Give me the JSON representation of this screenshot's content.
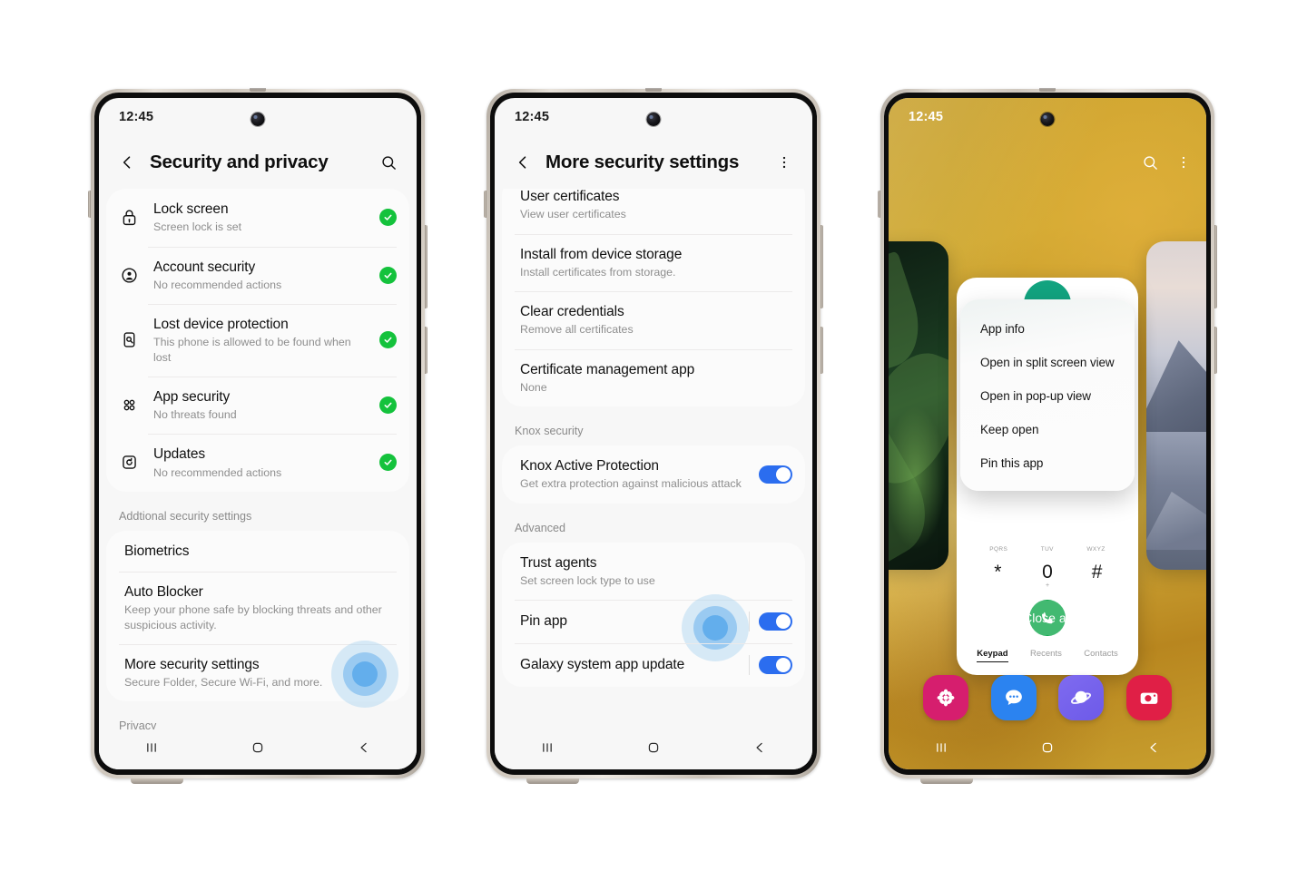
{
  "colors": {
    "accent_blue": "#2b6def",
    "ripple_blue": "#63aeec",
    "check_green": "#14c23c",
    "call_green": "#0ea64a",
    "wallpaper_gold": "#c8a02c",
    "frame_titanium": "#cfc7bd"
  },
  "phone1": {
    "status": {
      "time": "12:45"
    },
    "appbar": {
      "back_icon": "chevron-left-icon",
      "title": "Security and privacy",
      "action_icon": "search-icon"
    },
    "items": [
      {
        "icon": "lock-icon",
        "title": "Lock screen",
        "subtitle": "Screen lock is set",
        "status": "ok"
      },
      {
        "icon": "account-icon",
        "title": "Account security",
        "subtitle": "No recommended actions",
        "status": "ok"
      },
      {
        "icon": "find-phone-icon",
        "title": "Lost device protection",
        "subtitle": "This phone is allowed to be found when lost",
        "status": "ok"
      },
      {
        "icon": "apps-grid-icon",
        "title": "App security",
        "subtitle": "No threats found",
        "status": "ok"
      },
      {
        "icon": "update-icon",
        "title": "Updates",
        "subtitle": "No recommended actions",
        "status": "ok"
      }
    ],
    "section_header": "Addtional security settings",
    "items2": [
      {
        "title": "Biometrics",
        "subtitle": ""
      },
      {
        "title": "Auto Blocker",
        "subtitle": "Keep your phone safe by blocking threats and other suspicious activity."
      },
      {
        "title": "More security settings",
        "subtitle": "Secure Folder, Secure Wi-Fi, and more."
      }
    ],
    "section_header2": "Privacy",
    "navbar": {
      "recents": "recents-icon",
      "home": "home-icon",
      "back": "back-icon"
    }
  },
  "phone2": {
    "status": {
      "time": "12:45"
    },
    "appbar": {
      "back_icon": "chevron-left-icon",
      "title": "More security settings",
      "action_icon": "more-vertical-icon"
    },
    "group1": [
      {
        "title": "User certificates",
        "subtitle": "View user certificates"
      },
      {
        "title": "Install from device storage",
        "subtitle": "Install certificates from storage."
      },
      {
        "title": "Clear credentials",
        "subtitle": "Remove all certificates"
      },
      {
        "title": "Certificate management app",
        "subtitle": "None"
      }
    ],
    "section_knox": "Knox security",
    "group2": [
      {
        "title": "Knox Active Protection",
        "subtitle": "Get extra protection against malicious attack",
        "toggle": true
      }
    ],
    "section_advanced": "Advanced",
    "group3": [
      {
        "title": "Trust agents",
        "subtitle": "Set screen lock type to use",
        "toggle": false
      },
      {
        "title": "Pin app",
        "subtitle": "",
        "toggle": true
      },
      {
        "title": "Galaxy system app update",
        "subtitle": "",
        "toggle": true
      }
    ],
    "navbar": {
      "recents": "recents-icon",
      "home": "home-icon",
      "back": "back-icon"
    }
  },
  "phone3": {
    "status": {
      "time": "12:45"
    },
    "topbar": {
      "search_icon": "search-icon",
      "more_icon": "more-vertical-icon"
    },
    "popup_menu": [
      "App info",
      "Open in split screen view",
      "Open in pop-up view",
      "Keep open",
      "Pin this app"
    ],
    "dialer": {
      "letter_row": [
        "PQRS",
        "TUV",
        "WXYZ"
      ],
      "keys": [
        {
          "glyph": "*",
          "sub": ""
        },
        {
          "glyph": "0",
          "sub": "+"
        },
        {
          "glyph": "#",
          "sub": ""
        }
      ],
      "call_icon": "phone-call-icon",
      "tabs": [
        {
          "label": "Keypad",
          "active": true
        },
        {
          "label": "Recents",
          "active": false
        },
        {
          "label": "Contacts",
          "active": false
        }
      ]
    },
    "close_all_label": "Close all",
    "dock": [
      {
        "name": "gallery-app-icon",
        "label": "Gallery"
      },
      {
        "name": "messages-app-icon",
        "label": "Messages"
      },
      {
        "name": "internet-app-icon",
        "label": "Internet"
      },
      {
        "name": "camera-app-icon",
        "label": "Camera"
      }
    ],
    "navbar": {
      "recents": "recents-icon",
      "home": "home-icon",
      "back": "back-icon"
    }
  }
}
